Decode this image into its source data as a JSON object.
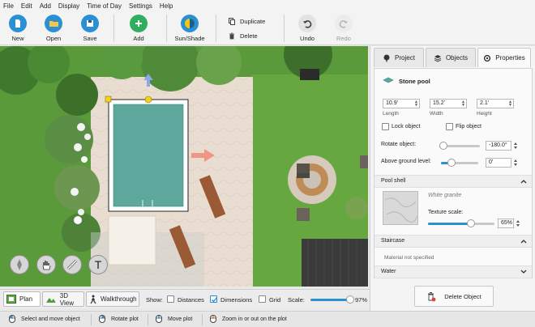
{
  "menu": [
    "File",
    "Edit",
    "Add",
    "Display",
    "Time of Day",
    "Settings",
    "Help"
  ],
  "toolbar": {
    "new": "New",
    "open": "Open",
    "save": "Save",
    "add": "Add",
    "sun_shade": "Sun/Shade",
    "duplicate": "Duplicate",
    "delete": "Delete",
    "undo": "Undo",
    "redo": "Redo"
  },
  "tabs": {
    "project": "Project",
    "objects": "Objects",
    "properties": "Properties"
  },
  "props": {
    "object_name": "Stone pool",
    "length": "10.9'",
    "length_label": "Length",
    "width": "15.2'",
    "width_label": "Width",
    "height": "2.1'",
    "height_label": "Height",
    "lock_object": "Lock object",
    "flip_object": "Flip object",
    "rotate_label": "Rotate object:",
    "rotate_value": "-180.0°",
    "rotate_fraction": 0.1,
    "ground_label": "Above ground level:",
    "ground_value": "0'",
    "ground_fraction": 0.28,
    "pool_shell": "Pool shell",
    "material": "White granite",
    "texture_scale_label": "Texture scale:",
    "texture_scale_value": "65%",
    "texture_scale_fraction": 0.65,
    "staircase": "Staircase",
    "staircase_material": "Material not specified",
    "water": "Water",
    "delete_object": "Delete Object"
  },
  "viewbar": {
    "plan": "Plan",
    "view3d": "3D View",
    "walkthrough": "Walkthrough",
    "show": "Show:",
    "distances": "Distances",
    "dimensions": "Dimensions",
    "grid": "Grid",
    "scale": "Scale:",
    "scale_value": "97%",
    "scale_fraction": 0.97
  },
  "status": {
    "select": "Select and move object",
    "rotate": "Rotate plot",
    "move": "Move plot",
    "zoom": "Zoom in or out on the plot"
  },
  "canvas": {
    "text_tool": "T"
  },
  "colors": {
    "accent_blue": "#2b8fd3",
    "add_green": "#2eae5e",
    "sun_yellow": "#f5c518"
  }
}
